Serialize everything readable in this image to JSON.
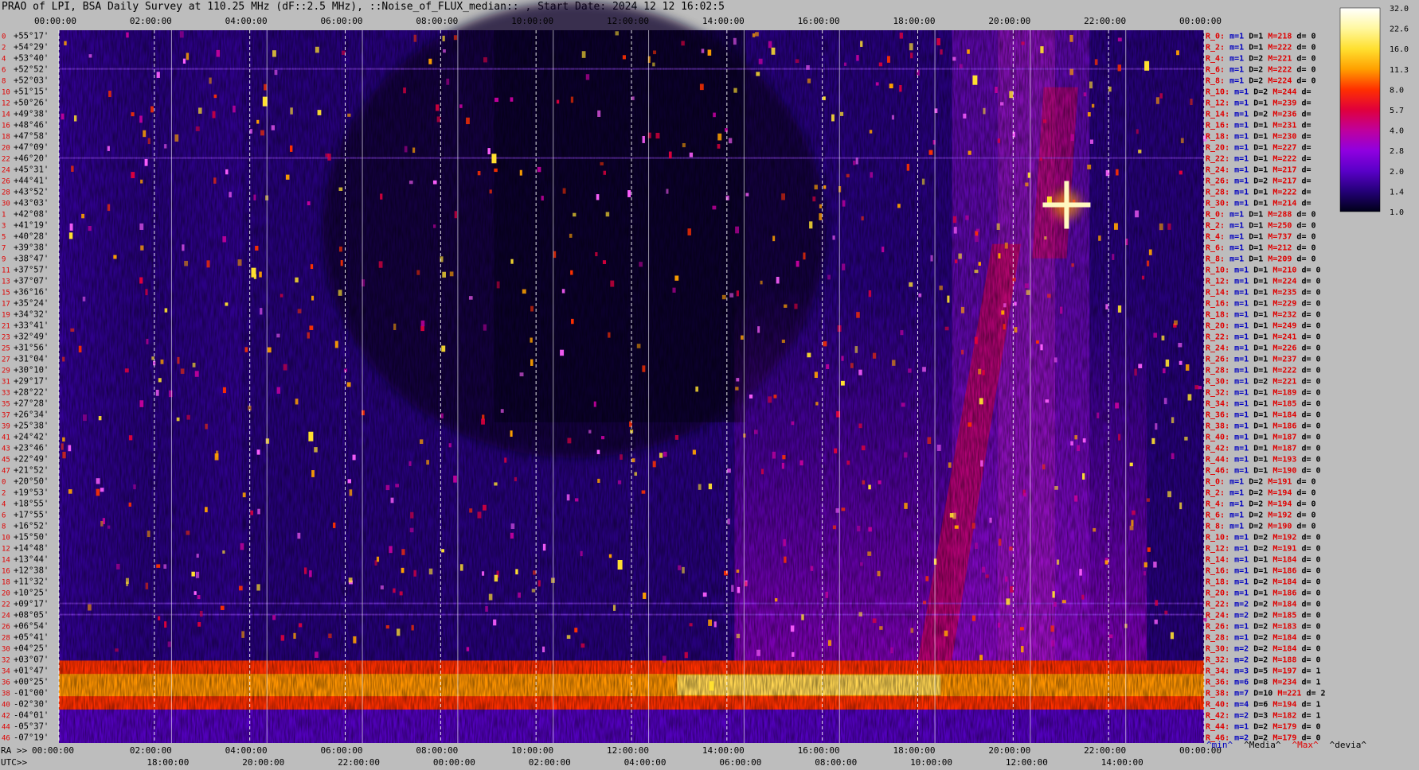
{
  "title": "PRAO of LPI, BSA Daily Survey at 110.25 MHz (dF::2.5 MHz), ::Noise_of_FLUX_median:: , Start Date: 2024 12 12 16:02:5",
  "chart_data": {
    "type": "heatmap",
    "x_top_ticks": [
      "00:00:00",
      "02:00:00",
      "04:00:00",
      "06:00:00",
      "08:00:00",
      "10:00:00",
      "12:00:00",
      "14:00:00",
      "16:00:00",
      "18:00:00",
      "20:00:00",
      "22:00:00",
      "00:00:00"
    ],
    "x_ra_label": "RA >>",
    "x_ra_ticks": [
      "00:00:00",
      "02:00:00",
      "04:00:00",
      "06:00:00",
      "08:00:00",
      "10:00:00",
      "12:00:00",
      "14:00:00",
      "16:00:00",
      "18:00:00",
      "20:00:00",
      "22:00:00",
      "00:00:00"
    ],
    "x_utc_label": "UTC>>",
    "x_utc_ticks": [
      "18:00:00",
      "20:00:00",
      "22:00:00",
      "00:00:00",
      "02:00:00",
      "04:00:00",
      "06:00:00",
      "08:00:00",
      "10:00:00",
      "12:00:00",
      "14:00:00"
    ],
    "dec_labels": [
      "+55°17'",
      "+54°29'",
      "+53°40'",
      "+52°52'",
      "+52°03'",
      "+51°15'",
      "+50°26'",
      "+49°38'",
      "+48°46'",
      "+47°58'",
      "+47°09'",
      "+46°20'",
      "+45°31'",
      "+44°41'",
      "+43°52'",
      "+43°03'",
      "+42°08'",
      "+41°19'",
      "+40°28'",
      "+39°38'",
      "+38°47'",
      "+37°57'",
      "+37°07'",
      "+36°16'",
      "+35°24'",
      "+34°32'",
      "+33°41'",
      "+32°49'",
      "+31°56'",
      "+31°04'",
      "+30°10'",
      "+29°17'",
      "+28°22'",
      "+27°28'",
      "+26°34'",
      "+25°38'",
      "+24°42'",
      "+23°46'",
      "+22°49'",
      "+21°52'",
      "+20°50'",
      "+19°53'",
      "+18°55'",
      "+17°55'",
      "+16°52'",
      "+15°50'",
      "+14°48'",
      "+13°44'",
      "+12°38'",
      "+11°32'",
      "+10°25'",
      "+09°17'",
      "+08°05'",
      "+06°54'",
      "+05°41'",
      "+04°25'",
      "+03°07'",
      "+01°47'",
      "+00°25'",
      "-01°00'",
      "-02°30'",
      "-04°01'",
      "-05°37'",
      "-07°19'"
    ],
    "row_ids": [
      "0",
      "2",
      "4",
      "6",
      "8",
      "10",
      "12",
      "14",
      "16",
      "18",
      "20",
      "22",
      "24",
      "26",
      "28",
      "30",
      "1",
      "3",
      "5",
      "7",
      "9",
      "11",
      "13",
      "15",
      "17",
      "19",
      "21",
      "23",
      "25",
      "27",
      "29",
      "31",
      "33",
      "35",
      "37",
      "39",
      "41",
      "43",
      "45",
      "47",
      "0",
      "2",
      "4",
      "6",
      "8",
      "10",
      "12",
      "14",
      "16",
      "18",
      "20",
      "22",
      "24",
      "26",
      "28",
      "30",
      "32",
      "34",
      "36",
      "38",
      "40",
      "42",
      "44",
      "46"
    ],
    "right_stats": [
      {
        "id": "R_0:",
        "m": "m=1",
        "D": "D=1",
        "M": "M=218",
        "d": "d= 0"
      },
      {
        "id": "R_2:",
        "m": "m=1",
        "D": "D=1",
        "M": "M=222",
        "d": "d= 0"
      },
      {
        "id": "R_4:",
        "m": "m=1",
        "D": "D=2",
        "M": "M=221",
        "d": "d= 0"
      },
      {
        "id": "R_6:",
        "m": "m=1",
        "D": "D=2",
        "M": "M=222",
        "d": "d= 0"
      },
      {
        "id": "R_8:",
        "m": "m=1",
        "D": "D=2",
        "M": "M=224",
        "d": "d= 0"
      },
      {
        "id": "R_10:",
        "m": "m=1",
        "D": "D=2",
        "M": "M=244",
        "d": "d="
      },
      {
        "id": "R_12:",
        "m": "m=1",
        "D": "D=1",
        "M": "M=239",
        "d": "d="
      },
      {
        "id": "R_14:",
        "m": "m=1",
        "D": "D=2",
        "M": "M=236",
        "d": "d="
      },
      {
        "id": "R_16:",
        "m": "m=1",
        "D": "D=1",
        "M": "M=231",
        "d": "d="
      },
      {
        "id": "R_18:",
        "m": "m=1",
        "D": "D=1",
        "M": "M=230",
        "d": "d="
      },
      {
        "id": "R_20:",
        "m": "m=1",
        "D": "D=1",
        "M": "M=227",
        "d": "d="
      },
      {
        "id": "R_22:",
        "m": "m=1",
        "D": "D=1",
        "M": "M=222",
        "d": "d="
      },
      {
        "id": "R_24:",
        "m": "m=1",
        "D": "D=1",
        "M": "M=217",
        "d": "d="
      },
      {
        "id": "R_26:",
        "m": "m=1",
        "D": "D=2",
        "M": "M=217",
        "d": "d="
      },
      {
        "id": "R_28:",
        "m": "m=1",
        "D": "D=1",
        "M": "M=222",
        "d": "d="
      },
      {
        "id": "R_30:",
        "m": "m=1",
        "D": "D=1",
        "M": "M=214",
        "d": "d="
      },
      {
        "id": "R_0:",
        "m": "m=1",
        "D": "D=1",
        "M": "M=288",
        "d": "d= 0"
      },
      {
        "id": "R_2:",
        "m": "m=1",
        "D": "D=1",
        "M": "M=250",
        "d": "d= 0"
      },
      {
        "id": "R_4:",
        "m": "m=1",
        "D": "D=1",
        "M": "M=737",
        "d": "d= 0"
      },
      {
        "id": "R_6:",
        "m": "m=1",
        "D": "D=1",
        "M": "M=212",
        "d": "d= 0"
      },
      {
        "id": "R_8:",
        "m": "m=1",
        "D": "D=1",
        "M": "M=209",
        "d": "d= 0"
      },
      {
        "id": "R_10:",
        "m": "m=1",
        "D": "D=1",
        "M": "M=210",
        "d": "d= 0"
      },
      {
        "id": "R_12:",
        "m": "m=1",
        "D": "D=1",
        "M": "M=224",
        "d": "d= 0"
      },
      {
        "id": "R_14:",
        "m": "m=1",
        "D": "D=1",
        "M": "M=235",
        "d": "d= 0"
      },
      {
        "id": "R_16:",
        "m": "m=1",
        "D": "D=1",
        "M": "M=229",
        "d": "d= 0"
      },
      {
        "id": "R_18:",
        "m": "m=1",
        "D": "D=1",
        "M": "M=232",
        "d": "d= 0"
      },
      {
        "id": "R_20:",
        "m": "m=1",
        "D": "D=1",
        "M": "M=249",
        "d": "d= 0"
      },
      {
        "id": "R_22:",
        "m": "m=1",
        "D": "D=1",
        "M": "M=241",
        "d": "d= 0"
      },
      {
        "id": "R_24:",
        "m": "m=1",
        "D": "D=1",
        "M": "M=226",
        "d": "d= 0"
      },
      {
        "id": "R_26:",
        "m": "m=1",
        "D": "D=1",
        "M": "M=237",
        "d": "d= 0"
      },
      {
        "id": "R_28:",
        "m": "m=1",
        "D": "D=1",
        "M": "M=222",
        "d": "d= 0"
      },
      {
        "id": "R_30:",
        "m": "m=1",
        "D": "D=2",
        "M": "M=221",
        "d": "d= 0"
      },
      {
        "id": "R_32:",
        "m": "m=1",
        "D": "D=1",
        "M": "M=189",
        "d": "d= 0"
      },
      {
        "id": "R_34:",
        "m": "m=1",
        "D": "D=1",
        "M": "M=185",
        "d": "d= 0"
      },
      {
        "id": "R_36:",
        "m": "m=1",
        "D": "D=1",
        "M": "M=184",
        "d": "d= 0"
      },
      {
        "id": "R_38:",
        "m": "m=1",
        "D": "D=1",
        "M": "M=186",
        "d": "d= 0"
      },
      {
        "id": "R_40:",
        "m": "m=1",
        "D": "D=1",
        "M": "M=187",
        "d": "d= 0"
      },
      {
        "id": "R_42:",
        "m": "m=1",
        "D": "D=1",
        "M": "M=187",
        "d": "d= 0"
      },
      {
        "id": "R_44:",
        "m": "m=1",
        "D": "D=1",
        "M": "M=193",
        "d": "d= 0"
      },
      {
        "id": "R_46:",
        "m": "m=1",
        "D": "D=1",
        "M": "M=190",
        "d": "d= 0"
      },
      {
        "id": "R_0:",
        "m": "m=1",
        "D": "D=2",
        "M": "M=191",
        "d": "d= 0"
      },
      {
        "id": "R_2:",
        "m": "m=1",
        "D": "D=2",
        "M": "M=194",
        "d": "d= 0"
      },
      {
        "id": "R_4:",
        "m": "m=1",
        "D": "D=2",
        "M": "M=194",
        "d": "d= 0"
      },
      {
        "id": "R_6:",
        "m": "m=1",
        "D": "D=2",
        "M": "M=192",
        "d": "d= 0"
      },
      {
        "id": "R_8:",
        "m": "m=1",
        "D": "D=2",
        "M": "M=190",
        "d": "d= 0"
      },
      {
        "id": "R_10:",
        "m": "m=1",
        "D": "D=2",
        "M": "M=192",
        "d": "d= 0"
      },
      {
        "id": "R_12:",
        "m": "m=1",
        "D": "D=2",
        "M": "M=191",
        "d": "d= 0"
      },
      {
        "id": "R_14:",
        "m": "m=1",
        "D": "D=1",
        "M": "M=184",
        "d": "d= 0"
      },
      {
        "id": "R_16:",
        "m": "m=1",
        "D": "D=1",
        "M": "M=186",
        "d": "d= 0"
      },
      {
        "id": "R_18:",
        "m": "m=1",
        "D": "D=2",
        "M": "M=184",
        "d": "d= 0"
      },
      {
        "id": "R_20:",
        "m": "m=1",
        "D": "D=1",
        "M": "M=186",
        "d": "d= 0"
      },
      {
        "id": "R_22:",
        "m": "m=2",
        "D": "D=2",
        "M": "M=184",
        "d": "d= 0"
      },
      {
        "id": "R_24:",
        "m": "m=2",
        "D": "D=2",
        "M": "M=185",
        "d": "d= 0"
      },
      {
        "id": "R_26:",
        "m": "m=1",
        "D": "D=2",
        "M": "M=183",
        "d": "d= 0"
      },
      {
        "id": "R_28:",
        "m": "m=1",
        "D": "D=2",
        "M": "M=184",
        "d": "d= 0"
      },
      {
        "id": "R_30:",
        "m": "m=2",
        "D": "D=2",
        "M": "M=184",
        "d": "d= 0"
      },
      {
        "id": "R_32:",
        "m": "m=2",
        "D": "D=2",
        "M": "M=188",
        "d": "d= 0"
      },
      {
        "id": "R_34:",
        "m": "m=3",
        "D": "D=5",
        "M": "M=197",
        "d": "d= 1"
      },
      {
        "id": "R_36:",
        "m": "m=6",
        "D": "D=8",
        "M": "M=234",
        "d": "d= 1"
      },
      {
        "id": "R_38:",
        "m": "m=7",
        "D": "D=10",
        "M": "M=221",
        "d": "d= 2"
      },
      {
        "id": "R_40:",
        "m": "m=4",
        "D": "D=6",
        "M": "M=194",
        "d": "d= 1"
      },
      {
        "id": "R_42:",
        "m": "m=2",
        "D": "D=3",
        "M": "M=182",
        "d": "d= 1"
      },
      {
        "id": "R_44:",
        "m": "m=1",
        "D": "D=2",
        "M": "M=179",
        "d": "d= 0"
      },
      {
        "id": "R_46:",
        "m": "m=2",
        "D": "D=2",
        "M": "M=179",
        "d": "d= 0"
      }
    ],
    "colorbar": {
      "ticks": [
        "32.0",
        "22.6",
        "16.0",
        "11.3",
        "8.0",
        "5.7",
        "4.0",
        "2.8",
        "2.0",
        "1.4",
        "1.0"
      ],
      "stops": [
        "#ffffff",
        "#fff8a0",
        "#ffe030",
        "#ffa000",
        "#ff3000",
        "#e0003c",
        "#c0009c",
        "#9000e0",
        "#5a00c8",
        "#240078",
        "#000018"
      ]
    },
    "legend": [
      {
        "text": "^min^",
        "color": "#0000c0"
      },
      {
        "text": "^Media^",
        "color": "#000000"
      },
      {
        "text": "^Max^",
        "color": "#e00000"
      },
      {
        "text": "^devia^",
        "color": "#000000"
      }
    ],
    "grid": true
  }
}
